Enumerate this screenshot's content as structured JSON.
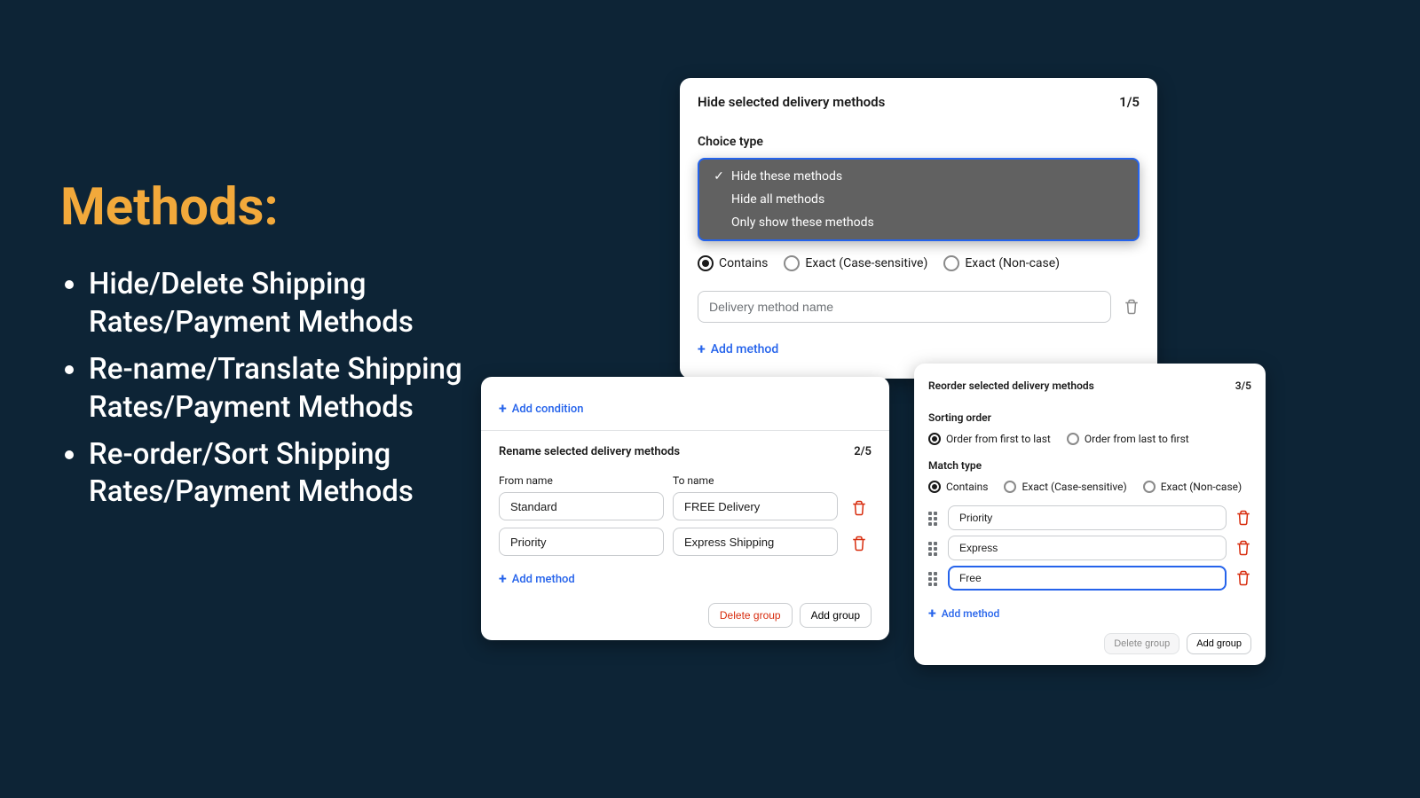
{
  "heading": "Methods:",
  "bullets": [
    "Hide/Delete Shipping Rates/Payment Methods",
    "Re-name/Translate Shipping Rates/Payment Methods",
    "Re-order/Sort Shipping Rates/Payment Methods"
  ],
  "card_hide": {
    "title": "Hide selected delivery methods",
    "counter": "1/5",
    "choice_label": "Choice type",
    "dropdown": {
      "options": [
        {
          "label": "Hide these methods",
          "selected": true
        },
        {
          "label": "Hide all methods",
          "selected": false
        },
        {
          "label": "Only show these methods",
          "selected": false
        }
      ]
    },
    "match_radios": [
      {
        "label": "Contains",
        "selected": true
      },
      {
        "label": "Exact (Case-sensitive)",
        "selected": false
      },
      {
        "label": "Exact (Non-case)",
        "selected": false
      }
    ],
    "method_input_placeholder": "Delivery method name",
    "add_method_label": "Add method"
  },
  "card_rename": {
    "add_condition_label": "Add condition",
    "title": "Rename selected delivery methods",
    "counter": "2/5",
    "from_label": "From name",
    "to_label": "To name",
    "rows": [
      {
        "from": "Standard",
        "to": "FREE Delivery"
      },
      {
        "from": "Priority",
        "to": "Express Shipping"
      }
    ],
    "add_method_label": "Add method",
    "delete_group_label": "Delete group",
    "add_group_label": "Add group"
  },
  "card_reorder": {
    "title": "Reorder selected delivery methods",
    "counter": "3/5",
    "sorting_label": "Sorting order",
    "sort_radios": [
      {
        "label": "Order from first to last",
        "selected": true
      },
      {
        "label": "Order from last to first",
        "selected": false
      }
    ],
    "match_label": "Match type",
    "match_radios": [
      {
        "label": "Contains",
        "selected": true
      },
      {
        "label": "Exact (Case-sensitive)",
        "selected": false
      },
      {
        "label": "Exact (Non-case)",
        "selected": false
      }
    ],
    "rows": [
      {
        "value": "Priority",
        "focused": false
      },
      {
        "value": "Express",
        "focused": false
      },
      {
        "value": "Free",
        "focused": true
      }
    ],
    "add_method_label": "Add method",
    "delete_group_label": "Delete group",
    "add_group_label": "Add group"
  }
}
